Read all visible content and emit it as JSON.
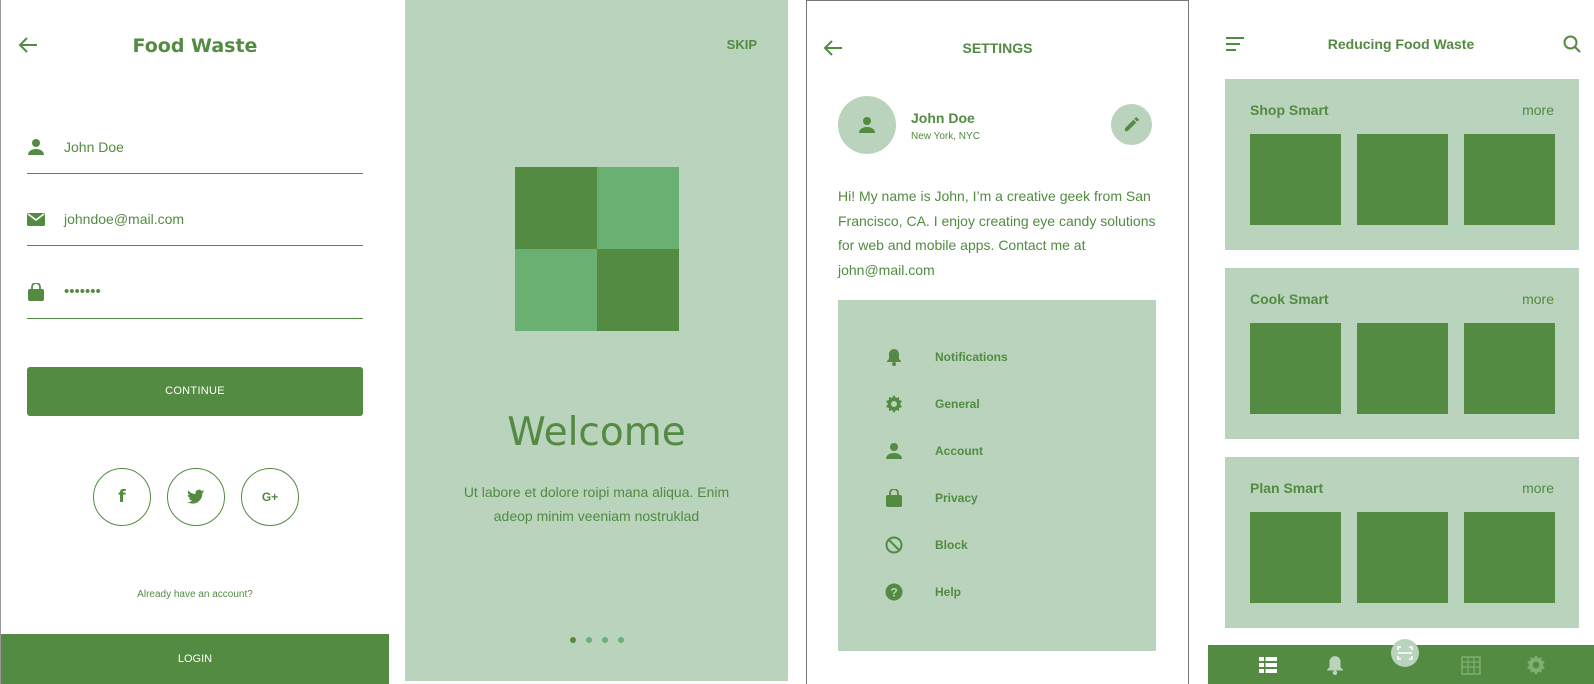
{
  "colors": {
    "green": "#528B41",
    "light": "#B9D3BC",
    "mid": "#6AB072"
  },
  "login_screen": {
    "title": "Food Waste",
    "name_value": "John Doe",
    "email_value": "johndoe@mail.com",
    "password_value": "•••••••",
    "continue_label": "CONTINUE",
    "social": [
      {
        "icon": "facebook-icon",
        "label": "f"
      },
      {
        "icon": "twitter-icon",
        "label": ""
      },
      {
        "icon": "google-plus-icon",
        "label": "G+"
      }
    ],
    "already_text": "Already have an account?",
    "login_label": "LOGIN"
  },
  "onboarding_screen": {
    "skip_label": "SKIP",
    "welcome": "Welcome",
    "subtitle": "Ut labore et dolore roipi mana aliqua. Enim adeop minim veeniam nostruklad",
    "page_dots": 4,
    "active_dot": 1
  },
  "settings_screen": {
    "title": "SETTINGS",
    "profile_name": "John Doe",
    "profile_location": "New York, NYC",
    "bio": "Hi! My name is John, I’m a creative geek from San Francisco, CA. I enjoy creating eye candy solutions for web and mobile apps. Contact me at john@mail.com",
    "menu": [
      {
        "label": "Notifications",
        "icon": "bell-icon"
      },
      {
        "label": "General",
        "icon": "gear-icon"
      },
      {
        "label": "Account",
        "icon": "person-icon"
      },
      {
        "label": "Privacy",
        "icon": "bag-icon"
      },
      {
        "label": "Block",
        "icon": "block-icon"
      },
      {
        "label": "Help",
        "icon": "help-icon"
      }
    ]
  },
  "home_screen": {
    "title": "Reducing Food Waste",
    "sections": [
      {
        "title": "Shop Smart",
        "more": "more"
      },
      {
        "title": "Cook Smart",
        "more": "more"
      },
      {
        "title": "Plan Smart",
        "more": "more"
      }
    ],
    "bottom_nav": [
      "list-icon",
      "bell-icon",
      "scan-icon",
      "calendar-icon",
      "gear-icon"
    ]
  }
}
